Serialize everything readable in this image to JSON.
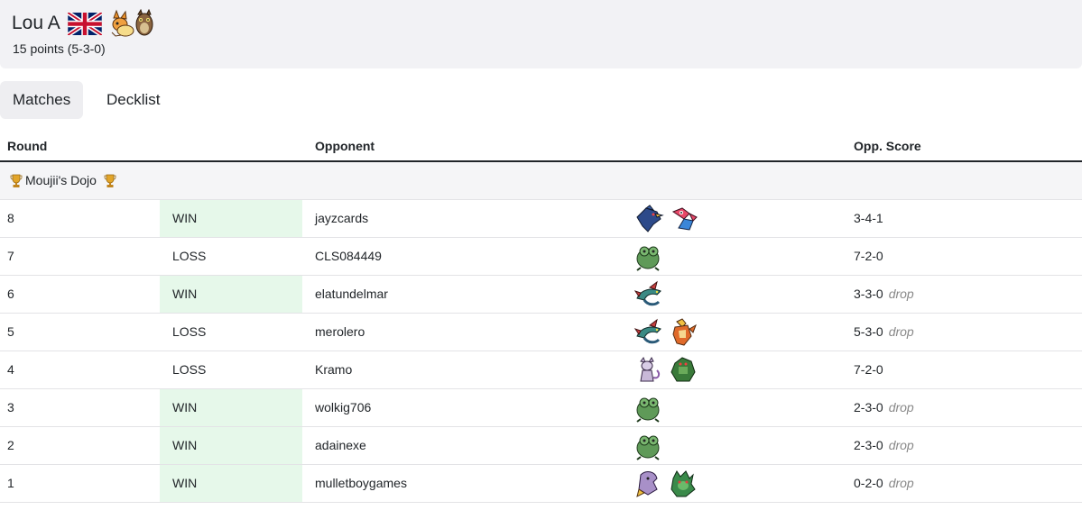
{
  "player": {
    "name": "Lou A",
    "points": "15 points (5-3-0)",
    "flag_icon": "uk-flag-icon",
    "deck_icons": [
      "flareon-sprite-icon",
      "noctowl-sprite-icon"
    ]
  },
  "tabs": [
    {
      "label": "Matches",
      "active": true
    },
    {
      "label": "Decklist",
      "active": false
    }
  ],
  "table": {
    "headers": {
      "round": "Round",
      "opponent": "Opponent",
      "opp_score": "Opp. Score"
    },
    "event": {
      "name": "Moujii's Dojo",
      "icon": "trophy-icon"
    },
    "rows": [
      {
        "round": "8",
        "result": "WIN",
        "opponent": "jayzcards",
        "score": "3-4-1",
        "drop": "",
        "sprites": [
          "dark-bird-sprite-icon",
          "porygon-sprite-icon"
        ]
      },
      {
        "round": "7",
        "result": "LOSS",
        "opponent": "CLS084449",
        "score": "7-2-0",
        "drop": "",
        "sprites": [
          "green-frog-sprite-icon"
        ]
      },
      {
        "round": "6",
        "result": "WIN",
        "opponent": "elatundelmar",
        "score": "3-3-0",
        "drop": "drop",
        "sprites": [
          "dragon-sprite-icon"
        ]
      },
      {
        "round": "5",
        "result": "LOSS",
        "opponent": "merolero",
        "score": "5-3-0",
        "drop": "drop",
        "sprites": [
          "dragon-sprite-icon",
          "fire-fighter-sprite-icon"
        ]
      },
      {
        "round": "4",
        "result": "LOSS",
        "opponent": "Kramo",
        "score": "7-2-0",
        "drop": "",
        "sprites": [
          "psychic-cat-sprite-icon",
          "green-armor-sprite-icon"
        ]
      },
      {
        "round": "3",
        "result": "WIN",
        "opponent": "wolkig706",
        "score": "2-3-0",
        "drop": "drop",
        "sprites": [
          "green-frog-sprite-icon"
        ]
      },
      {
        "round": "2",
        "result": "WIN",
        "opponent": "adainexe",
        "score": "2-3-0",
        "drop": "drop",
        "sprites": [
          "green-frog-sprite-icon"
        ]
      },
      {
        "round": "1",
        "result": "WIN",
        "opponent": "mulletboygames",
        "score": "0-2-0",
        "drop": "drop",
        "sprites": [
          "purple-ghost-sprite-icon",
          "grass-cat-sprite-icon"
        ]
      }
    ]
  },
  "colors": {
    "win_bg": "#e6f8ea",
    "header_bg": "#f2f2f5",
    "border": "#e3e3e6"
  }
}
